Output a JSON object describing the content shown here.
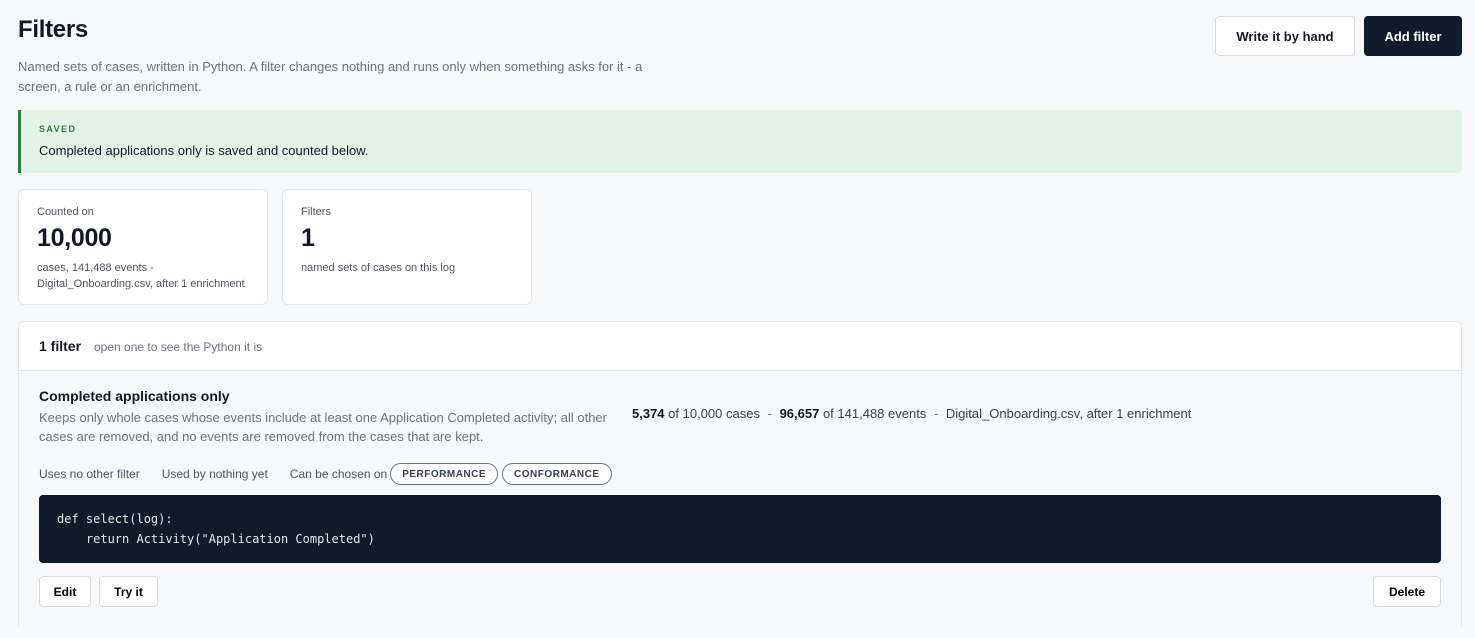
{
  "header": {
    "title": "Filters",
    "subtitle": "Named sets of cases, written in Python. A filter changes nothing and runs only when something asks for it - a screen, a rule or an enrichment.",
    "write_button": "Write it by hand",
    "add_button": "Add filter"
  },
  "banner": {
    "tag": "SAVED",
    "message": "Completed applications only is saved and counted below.",
    "accent_color": "#2e7d3f"
  },
  "stats": [
    {
      "label": "Counted on",
      "value": "10,000",
      "note": "cases, 141,488 events - Digital_Onboarding.csv, after 1 enrichment"
    },
    {
      "label": "Filters",
      "value": "1",
      "note": "named sets of cases on this log"
    }
  ],
  "list": {
    "count_label": "1 filter",
    "hint": "open one to see the Python it is"
  },
  "filter": {
    "name": "Completed applications only",
    "description": "Keeps only whole cases whose events include at least one Application Completed activity; all other cases are removed, and no events are removed from the cases that are kept.",
    "cases_kept": "5,374",
    "cases_of": "of 10,000 cases",
    "events_kept": "96,657",
    "events_of": "of 141,488 events",
    "source": "Digital_Onboarding.csv, after 1 enrichment",
    "separator": "-",
    "uses": "Uses no other filter",
    "used_by": "Used by nothing yet",
    "chosen_on_label": "Can be chosen on",
    "chips": [
      "PERFORMANCE",
      "CONFORMANCE"
    ],
    "code": "def select(log):\n    return Activity(\"Application Completed\")",
    "edit_button": "Edit",
    "try_button": "Try it",
    "delete_button": "Delete"
  }
}
